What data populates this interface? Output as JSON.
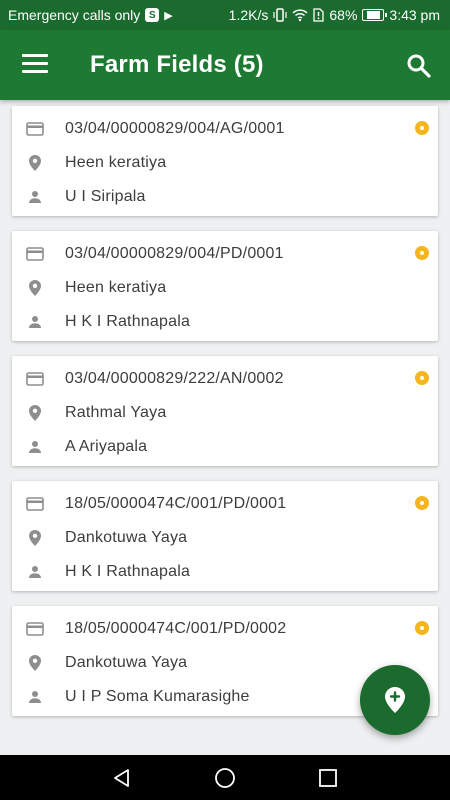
{
  "status_bar": {
    "carrier_text": "Emergency calls only",
    "badge_letter": "S",
    "network_speed": "1.2K/s",
    "battery_percent": "68%",
    "battery_level": 0.68,
    "time": "3:43 pm"
  },
  "app_bar": {
    "title": "Farm Fields (5)",
    "menu_icon": "hamburger-menu-icon",
    "search_icon": "search-icon"
  },
  "fields": [
    {
      "code": "03/04/00000829/004/AG/0001",
      "location": "Heen keratiya",
      "owner": "U I Siripala"
    },
    {
      "code": "03/04/00000829/004/PD/0001",
      "location": "Heen keratiya",
      "owner": "H K I Rathnapala"
    },
    {
      "code": "03/04/00000829/222/AN/0002",
      "location": "Rathmal Yaya",
      "owner": "A Ariyapala"
    },
    {
      "code": "18/05/0000474C/001/PD/0001",
      "location": "Dankotuwa Yaya",
      "owner": "H K I Rathnapala"
    },
    {
      "code": "18/05/0000474C/001/PD/0002",
      "location": "Dankotuwa Yaya",
      "owner": "U I P Soma Kumarasighe"
    }
  ],
  "colors": {
    "status_bar": "#1b6a2e",
    "app_bar": "#1e7a32",
    "status_dot": "#f5b51d",
    "fab": "#1b6a2e"
  },
  "fab": {
    "icon": "add-location-icon"
  },
  "nav_bar": {
    "icons": [
      "back-icon",
      "home-icon",
      "recents-icon"
    ]
  }
}
